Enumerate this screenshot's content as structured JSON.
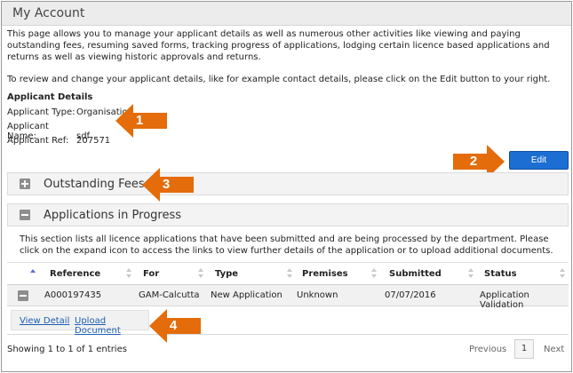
{
  "account": {
    "title": "My Account",
    "intro": "This page allows you to manage your applicant details as well as numerous other activities like viewing and paying outstanding fees, resuming saved forms, tracking progress of applications, lodging certain licence based applications and returns as well as viewing historic approvals and returns.",
    "intro2": "To review and change your applicant details, like for example contact details, please click on the Edit button to your right."
  },
  "applicant": {
    "heading": "Applicant Details",
    "type_label": "Applicant Type:",
    "type_value": "Organisation",
    "name_label": "Applicant Name:",
    "name_value": "sdf",
    "ref_label": "Applicant Ref:",
    "ref_value": "207571"
  },
  "edit_button": "Edit",
  "outstanding_fees": {
    "title": "Outstanding Fees"
  },
  "applications": {
    "title": "Applications in Progress",
    "description": "This section lists all licence applications that have been submitted and are being processed by the department. Please click on the expand icon to access the links to view further details of the application or to upload additional documents.",
    "columns": [
      "Reference",
      "For",
      "Type",
      "Premises",
      "Submitted",
      "Status"
    ],
    "rows": [
      {
        "reference": "A000197435",
        "for": "GAM-Calcutta",
        "type": "New Application",
        "premises": "Unknown",
        "submitted": "07/07/2016",
        "status": "Application Validation"
      }
    ],
    "links": {
      "view_detail": "View Detail",
      "upload_document": "Upload Document"
    }
  },
  "pagination": {
    "showing": "Showing 1 to 1 of 1 entries",
    "previous": "Previous",
    "page": "1",
    "next": "Next"
  },
  "callouts": [
    "1",
    "2",
    "3",
    "4"
  ],
  "colors": {
    "callout": "#e46c0a",
    "edit_button": "#1c6ed2",
    "link": "#1c5fb4"
  }
}
